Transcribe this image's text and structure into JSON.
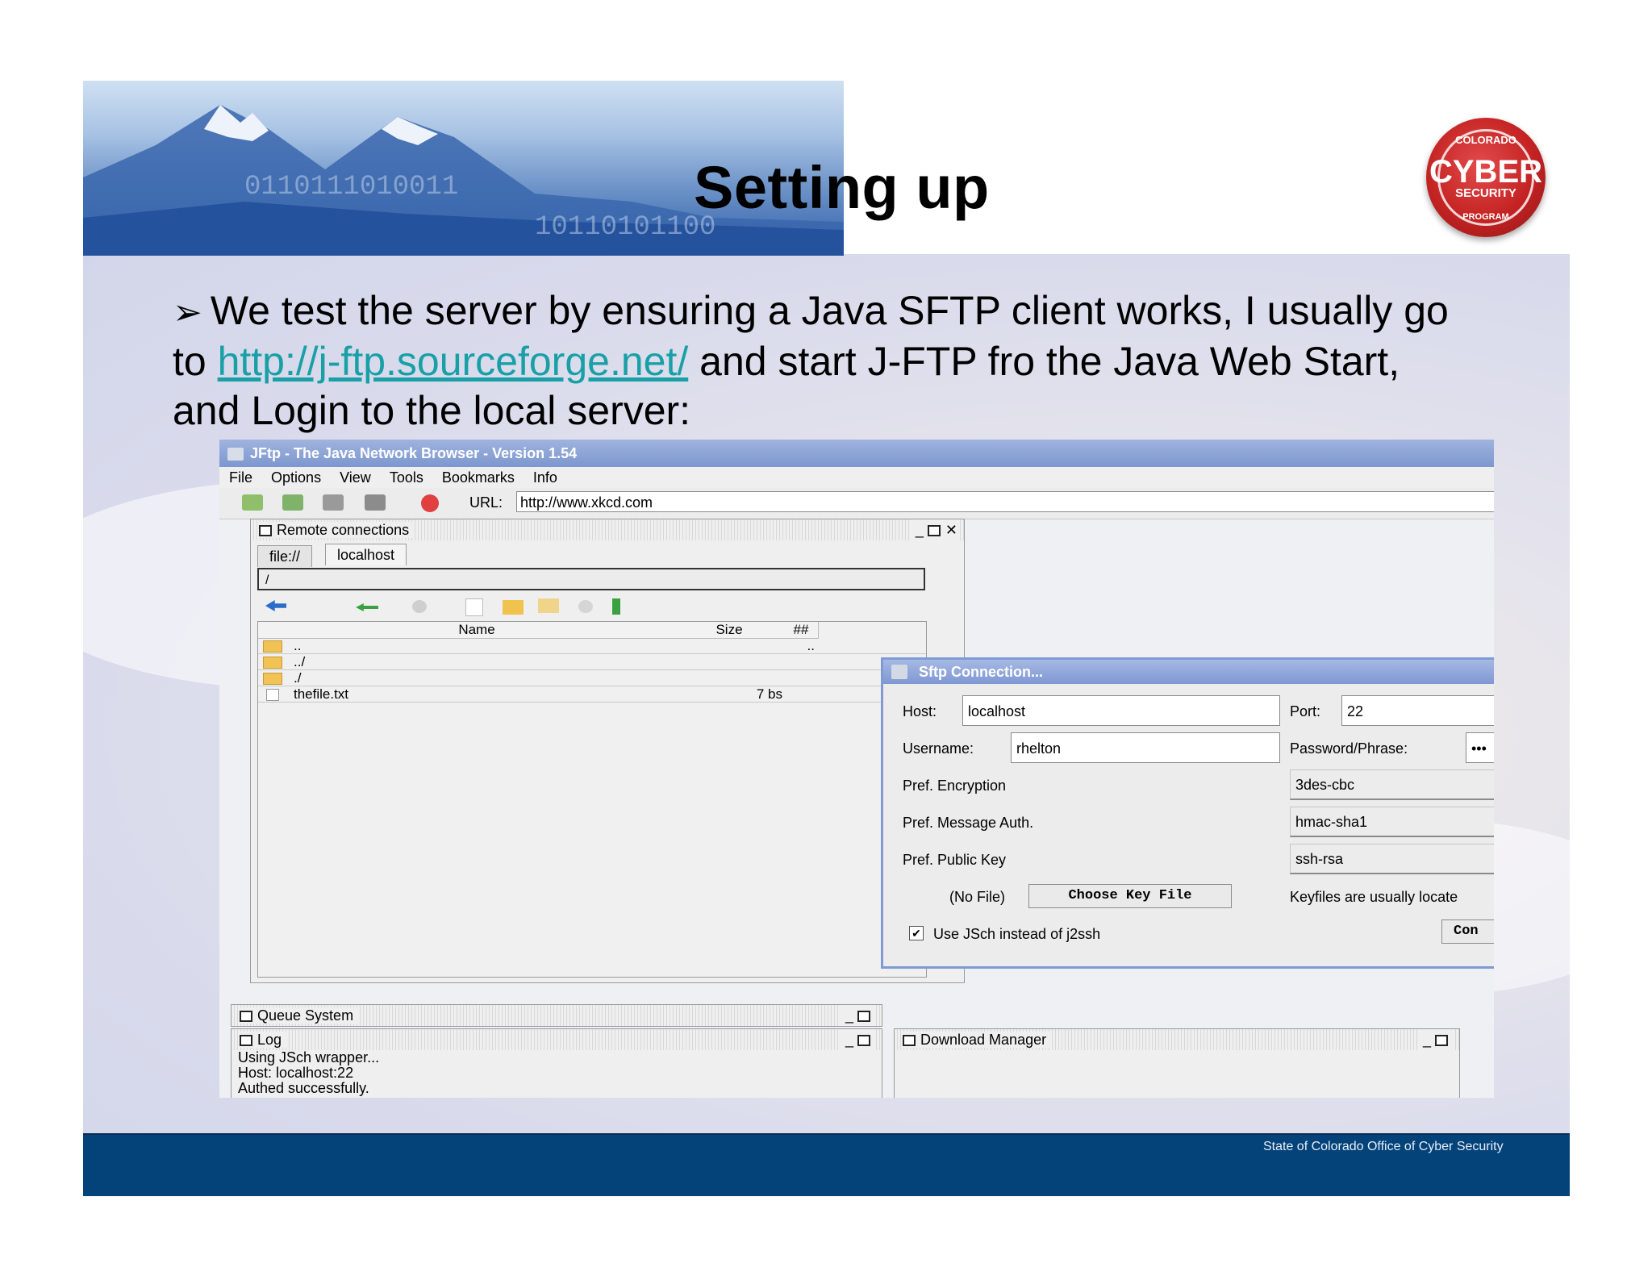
{
  "slide": {
    "title": "Setting up",
    "bullet_prefix": "We test the server by ensuring a Java SFTP client works, I usually go to ",
    "link_text": "http://j-ftp.sourceforge.net/",
    "bullet_suffix": " and start J-FTP fro the Java Web Start, and Login to the local server:",
    "footer": "State of Colorado Office of Cyber Security",
    "logo": {
      "top_text": "COLORADO",
      "main_text": "CYBER",
      "sub_text": "SECURITY",
      "bottom_text": "PROGRAM"
    }
  },
  "jftp": {
    "window_title": "JFtp - The Java Network Browser - Version 1.54",
    "menu": [
      "File",
      "Options",
      "View",
      "Tools",
      "Bookmarks",
      "Info"
    ],
    "url_label": "URL:",
    "url_value": "http://www.xkcd.com",
    "remote_panel": {
      "title": "Remote connections",
      "tabs": [
        "file://",
        "localhost"
      ],
      "path": "/",
      "columns": [
        "Name",
        "Size",
        "##"
      ],
      "rows": [
        {
          "name": "..",
          "size": "",
          "flag": ".."
        },
        {
          "name": "../",
          "size": "",
          "flag": ""
        },
        {
          "name": "./",
          "size": "",
          "flag": ""
        },
        {
          "name": "thefile.txt",
          "size": "7 bs",
          "flag": ""
        }
      ]
    },
    "queue_title": "Queue System",
    "log_title": "Log",
    "log_lines": [
      "Using JSch wrapper...",
      "Host: localhost:22",
      "Authed successfully."
    ],
    "download_title": "Download Manager"
  },
  "sftp_dialog": {
    "title": "Sftp Connection...",
    "host_label": "Host:",
    "host_value": "localhost",
    "port_label": "Port:",
    "port_value": "22",
    "username_label": "Username:",
    "username_value": "rhelton",
    "password_label": "Password/Phrase:",
    "password_value": "•••",
    "encryption_label": "Pref. Encryption",
    "encryption_value": "3des-cbc",
    "mac_label": "Pref. Message Auth.",
    "mac_value": "hmac-sha1",
    "pubkey_label": "Pref. Public Key",
    "pubkey_value": "ssh-rsa",
    "no_file_label": "(No File)",
    "choose_key_button": "Choose Key File",
    "keyfiles_hint": "Keyfiles are usually locate",
    "jsch_checkbox_label": "Use JSch instead of j2ssh",
    "jsch_checked": true,
    "connect_button": "Con"
  }
}
